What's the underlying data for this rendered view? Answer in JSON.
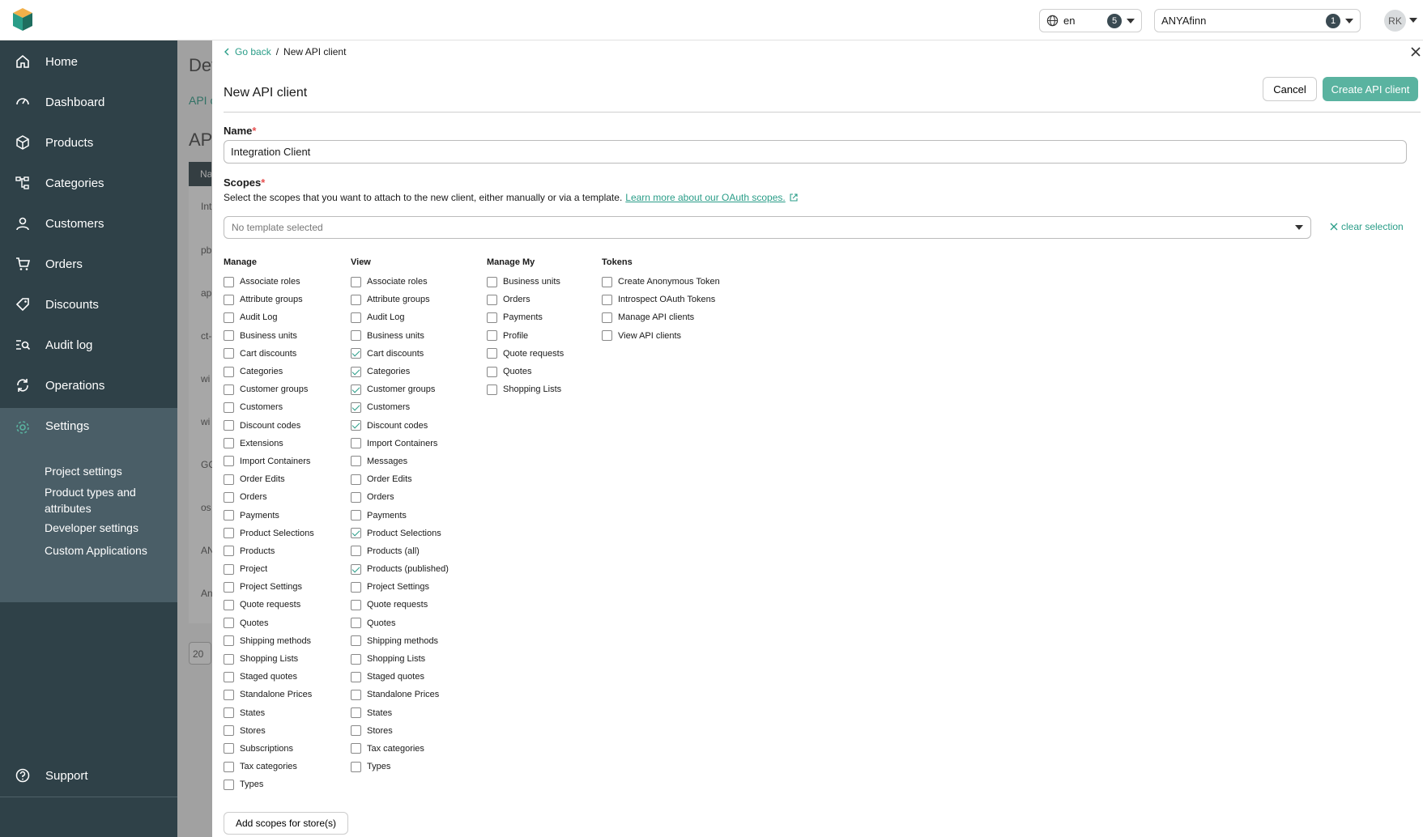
{
  "topbar": {
    "language": "en",
    "language_count": "5",
    "project": "ANYAfinn",
    "project_count": "1",
    "avatar_initials": "RK"
  },
  "sidebar": {
    "items": [
      {
        "label": "Home",
        "icon": "home-icon"
      },
      {
        "label": "Dashboard",
        "icon": "gauge-icon"
      },
      {
        "label": "Products",
        "icon": "box-icon"
      },
      {
        "label": "Categories",
        "icon": "tree-icon"
      },
      {
        "label": "Customers",
        "icon": "user-icon"
      },
      {
        "label": "Orders",
        "icon": "cart-icon"
      },
      {
        "label": "Discounts",
        "icon": "tag-icon"
      },
      {
        "label": "Audit log",
        "icon": "search-list-icon"
      },
      {
        "label": "Operations",
        "icon": "refresh-icon"
      },
      {
        "label": "Settings",
        "icon": "gear-icon"
      }
    ],
    "settings_sub": [
      "Project settings",
      "Product types and attributes",
      "Developer settings",
      "Custom Applications"
    ],
    "support": "Support"
  },
  "background": {
    "title": "Dev",
    "tab": "API c",
    "h2": "API",
    "header": "Na",
    "rows": [
      "Int",
      "pb",
      "ap",
      "ct-",
      "wi",
      "wi",
      "GC",
      "os",
      "AN",
      "An"
    ],
    "page_size": "20"
  },
  "breadcrumb": {
    "back": "Go back",
    "separator": "/",
    "current": "New API client"
  },
  "panel": {
    "title": "New API client",
    "cancel": "Cancel",
    "create": "Create API client",
    "add_store": "Add scopes for store(s)"
  },
  "form": {
    "name_label": "Name",
    "name_value": "Integration Client",
    "required_mark": "*",
    "scopes_label": "Scopes",
    "scopes_desc": "Select the scopes that you want to attach to the new client, either manually or via a template.",
    "scopes_link": "Learn more about our OAuth scopes.",
    "template_placeholder": "No template selected",
    "clear_selection": "clear selection"
  },
  "scope_columns": [
    {
      "title": "Manage",
      "items": [
        {
          "label": "Associate roles",
          "checked": false
        },
        {
          "label": "Attribute groups",
          "checked": false
        },
        {
          "label": "Audit Log",
          "checked": false
        },
        {
          "label": "Business units",
          "checked": false
        },
        {
          "label": "Cart discounts",
          "checked": false
        },
        {
          "label": "Categories",
          "checked": false
        },
        {
          "label": "Customer groups",
          "checked": false
        },
        {
          "label": "Customers",
          "checked": false
        },
        {
          "label": "Discount codes",
          "checked": false
        },
        {
          "label": "Extensions",
          "checked": false
        },
        {
          "label": "Import Containers",
          "checked": false
        },
        {
          "label": "Order Edits",
          "checked": false
        },
        {
          "label": "Orders",
          "checked": false
        },
        {
          "label": "Payments",
          "checked": false
        },
        {
          "label": "Product Selections",
          "checked": false
        },
        {
          "label": "Products",
          "checked": false
        },
        {
          "label": "Project",
          "checked": false
        },
        {
          "label": "Project Settings",
          "checked": false
        },
        {
          "label": "Quote requests",
          "checked": false
        },
        {
          "label": "Quotes",
          "checked": false
        },
        {
          "label": "Shipping methods",
          "checked": false
        },
        {
          "label": "Shopping Lists",
          "checked": false
        },
        {
          "label": "Staged quotes",
          "checked": false
        },
        {
          "label": "Standalone Prices",
          "checked": false
        },
        {
          "label": "States",
          "checked": false
        },
        {
          "label": "Stores",
          "checked": false
        },
        {
          "label": "Subscriptions",
          "checked": false
        },
        {
          "label": "Tax categories",
          "checked": false
        },
        {
          "label": "Types",
          "checked": false
        }
      ]
    },
    {
      "title": "View",
      "items": [
        {
          "label": "Associate roles",
          "checked": false
        },
        {
          "label": "Attribute groups",
          "checked": false
        },
        {
          "label": "Audit Log",
          "checked": false
        },
        {
          "label": "Business units",
          "checked": false
        },
        {
          "label": "Cart discounts",
          "checked": true
        },
        {
          "label": "Categories",
          "checked": true
        },
        {
          "label": "Customer groups",
          "checked": true
        },
        {
          "label": "Customers",
          "checked": true
        },
        {
          "label": "Discount codes",
          "checked": true
        },
        {
          "label": "Import Containers",
          "checked": false
        },
        {
          "label": "Messages",
          "checked": false
        },
        {
          "label": "Order Edits",
          "checked": false
        },
        {
          "label": "Orders",
          "checked": false
        },
        {
          "label": "Payments",
          "checked": false
        },
        {
          "label": "Product Selections",
          "checked": true
        },
        {
          "label": "Products (all)",
          "checked": false
        },
        {
          "label": "Products (published)",
          "checked": true
        },
        {
          "label": "Project Settings",
          "checked": false
        },
        {
          "label": "Quote requests",
          "checked": false
        },
        {
          "label": "Quotes",
          "checked": false
        },
        {
          "label": "Shipping methods",
          "checked": false
        },
        {
          "label": "Shopping Lists",
          "checked": false
        },
        {
          "label": "Staged quotes",
          "checked": false
        },
        {
          "label": "Standalone Prices",
          "checked": false
        },
        {
          "label": "States",
          "checked": false
        },
        {
          "label": "Stores",
          "checked": false
        },
        {
          "label": "Tax categories",
          "checked": false
        },
        {
          "label": "Types",
          "checked": false
        }
      ]
    },
    {
      "title": "Manage My",
      "items": [
        {
          "label": "Business units",
          "checked": false
        },
        {
          "label": "Orders",
          "checked": false
        },
        {
          "label": "Payments",
          "checked": false
        },
        {
          "label": "Profile",
          "checked": false
        },
        {
          "label": "Quote requests",
          "checked": false
        },
        {
          "label": "Quotes",
          "checked": false
        },
        {
          "label": "Shopping Lists",
          "checked": false
        }
      ]
    },
    {
      "title": "Tokens",
      "items": [
        {
          "label": "Create Anonymous Token",
          "checked": false
        },
        {
          "label": "Introspect OAuth Tokens",
          "checked": false
        },
        {
          "label": "Manage API clients",
          "checked": false
        },
        {
          "label": "View API clients",
          "checked": false
        }
      ]
    }
  ],
  "colors": {
    "accent": "#2a9d88",
    "sidebar": "#2f4148",
    "sidebar_active": "#4a5e67",
    "create_button": "#5ab3a0",
    "required": "#e65050"
  }
}
